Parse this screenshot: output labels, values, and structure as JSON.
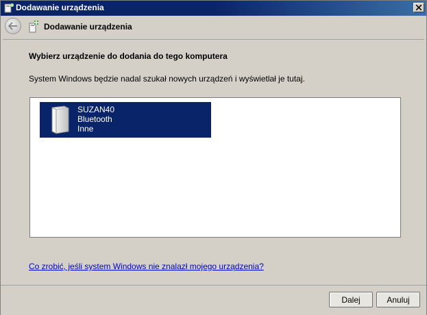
{
  "window": {
    "title": "Dodawanie urządzenia"
  },
  "header": {
    "title": "Dodawanie urządzenia"
  },
  "main": {
    "heading": "Wybierz urządzenie do dodania do tego komputera",
    "info": "System Windows będzie nadal szukał nowych urządzeń i wyświetlał je tutaj.",
    "devices": [
      {
        "name": "SUZAN40",
        "type": "Bluetooth",
        "category": "Inne",
        "icon": "device-tower-icon",
        "selected": true
      }
    ],
    "help_link": "Co zrobić, jeśli system Windows nie znalazł mojego urządzenia?"
  },
  "footer": {
    "next_label": "Dalej",
    "cancel_label": "Anuluj"
  },
  "colors": {
    "selection": "#0a246a",
    "link": "#0000cc",
    "window_bg": "#d4d0c8"
  }
}
